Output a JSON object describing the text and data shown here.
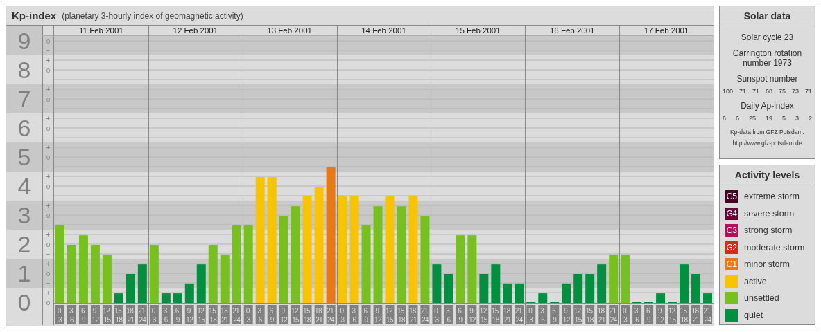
{
  "kp_chart": {
    "title": "Kp-index",
    "subtitle": "(planetary 3-hourly index of geomagnetic activity)",
    "days": [
      "11 Feb 2001",
      "12 Feb 2001",
      "13 Feb 2001",
      "14 Feb 2001",
      "15 Feb 2001",
      "16 Feb 2001",
      "17 Feb 2001"
    ],
    "scale_marks": [
      "o",
      "−",
      "+",
      "o",
      "−",
      "+",
      "o",
      "−",
      "+",
      "o",
      "−",
      "+",
      "o",
      "−",
      "+",
      "o",
      "−",
      "+",
      "o",
      "−",
      "+",
      "o",
      "−",
      "+",
      "o",
      "−",
      "+",
      "o"
    ],
    "chart_data": {
      "type": "bar",
      "ylim": [
        0,
        9
      ],
      "grid": true,
      "yticks": [
        0,
        1,
        2,
        3,
        4,
        5,
        6,
        7,
        8,
        9
      ],
      "categories": [
        "0 3",
        "3 6",
        "6 9",
        "9 12",
        "12 15",
        "15 18",
        "18 21",
        "21 24",
        "0 3",
        "3 6",
        "6 9",
        "9 12",
        "12 15",
        "15 18",
        "18 21",
        "21 24",
        "0 3",
        "3 6",
        "6 9",
        "9 12",
        "12 15",
        "15 18",
        "18 21",
        "21 24",
        "0 3",
        "3 6",
        "6 9",
        "9 12",
        "12 15",
        "15 18",
        "18 21",
        "21 24",
        "0 3",
        "3 6",
        "6 9",
        "9 12",
        "12 15",
        "15 18",
        "18 21",
        "21 24",
        "0 3",
        "3 6",
        "6 9",
        "9 12",
        "12 15",
        "15 18",
        "18 21",
        "21 24",
        "0 3",
        "3 6",
        "6 9",
        "9 12",
        "12 15",
        "15 18",
        "18 21",
        "21 24"
      ],
      "series": [
        {
          "values": [
            2.67,
            2,
            2.33,
            2,
            1.67,
            0.33,
            1,
            1.33,
            2,
            0.33,
            0.33,
            0.67,
            1.33,
            2,
            1.67,
            2.67,
            2.67,
            4.33,
            4.33,
            3,
            3.33,
            3.67,
            4,
            4.67,
            3.67,
            3.67,
            2.67,
            3.33,
            3.67,
            3.33,
            3.67,
            3,
            1.33,
            1,
            2.33,
            2.33,
            1,
            1.33,
            0.67,
            0.67,
            0,
            0.33,
            0,
            0.67,
            1,
            1,
            1.33,
            1.67,
            1.67,
            0,
            0,
            0.33,
            0,
            1.33,
            1,
            0.33
          ]
        }
      ]
    }
  },
  "solar_data": {
    "title": "Solar data",
    "cycle": "Solar cycle 23",
    "rotation": "Carrington rotation number 1973",
    "sunspot_label": "Sunspot number",
    "sunspots": [
      "100",
      "71",
      "71",
      "68",
      "75",
      "73",
      "71"
    ],
    "ap_label": "Daily Ap-index",
    "ap_values": [
      "6",
      "6",
      "25",
      "19",
      "5",
      "3",
      "2"
    ],
    "credit": "Kp-data from GFZ Potsdam:",
    "credit_link": "http://www.gfz-potsdam.de"
  },
  "activity_levels": {
    "title": "Activity levels",
    "items": [
      {
        "badge": "G5",
        "label": "extreme storm",
        "color": "#4c0024"
      },
      {
        "badge": "G4",
        "label": "severe storm",
        "color": "#6c0038"
      },
      {
        "badge": "G3",
        "label": "strong storm",
        "color": "#b0105c"
      },
      {
        "badge": "G2",
        "label": "moderate storm",
        "color": "#d82818"
      },
      {
        "badge": "G1",
        "label": "minor storm",
        "color": "#e87818"
      },
      {
        "label": "active",
        "color": "#f8c400"
      },
      {
        "label": "unsettled",
        "color": "#78c020"
      },
      {
        "label": "quiet",
        "color": "#009040"
      }
    ]
  }
}
